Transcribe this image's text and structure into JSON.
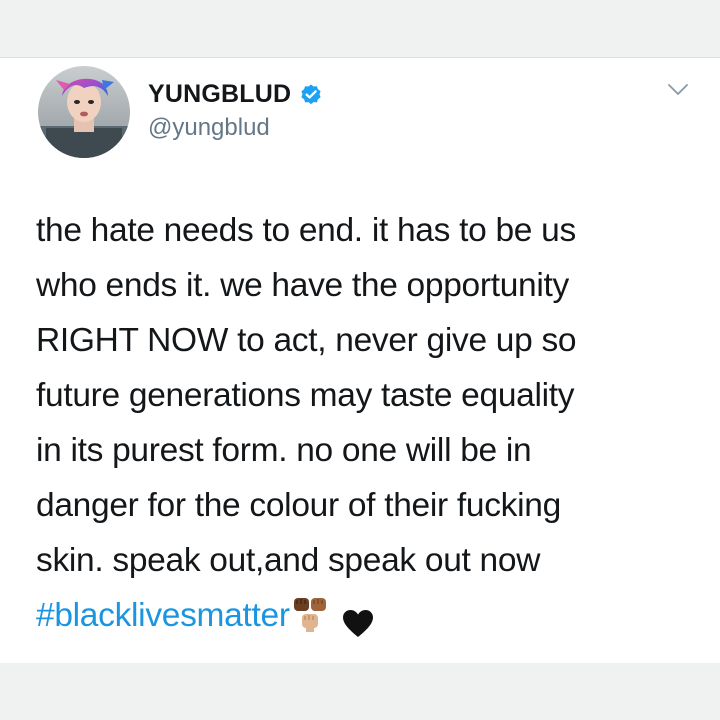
{
  "tweet": {
    "display_name": "YUNGBLUD",
    "handle": "@yungblud",
    "verified": true,
    "lines": [
      "the hate needs to end. it has to be us",
      "who ends it. we have the opportunity",
      "RIGHT NOW to act, never give up so",
      "future generations may taste equality",
      "in its purest form. no one will be in",
      "danger for the colour of their fucking",
      "skin. speak out,and speak out now"
    ],
    "hashtag": "#blacklivesmatter",
    "emojis": [
      "raised-fists-emoji",
      "black-heart-emoji"
    ]
  },
  "icons": {
    "verified": "verified-badge-icon",
    "menu": "chevron-down-icon"
  },
  "colors": {
    "background": "#f0f1f1",
    "card": "#ffffff",
    "text": "#14171a",
    "secondary_text": "#657786",
    "link": "#1b95e0",
    "verified_blue": "#1da1f2"
  }
}
